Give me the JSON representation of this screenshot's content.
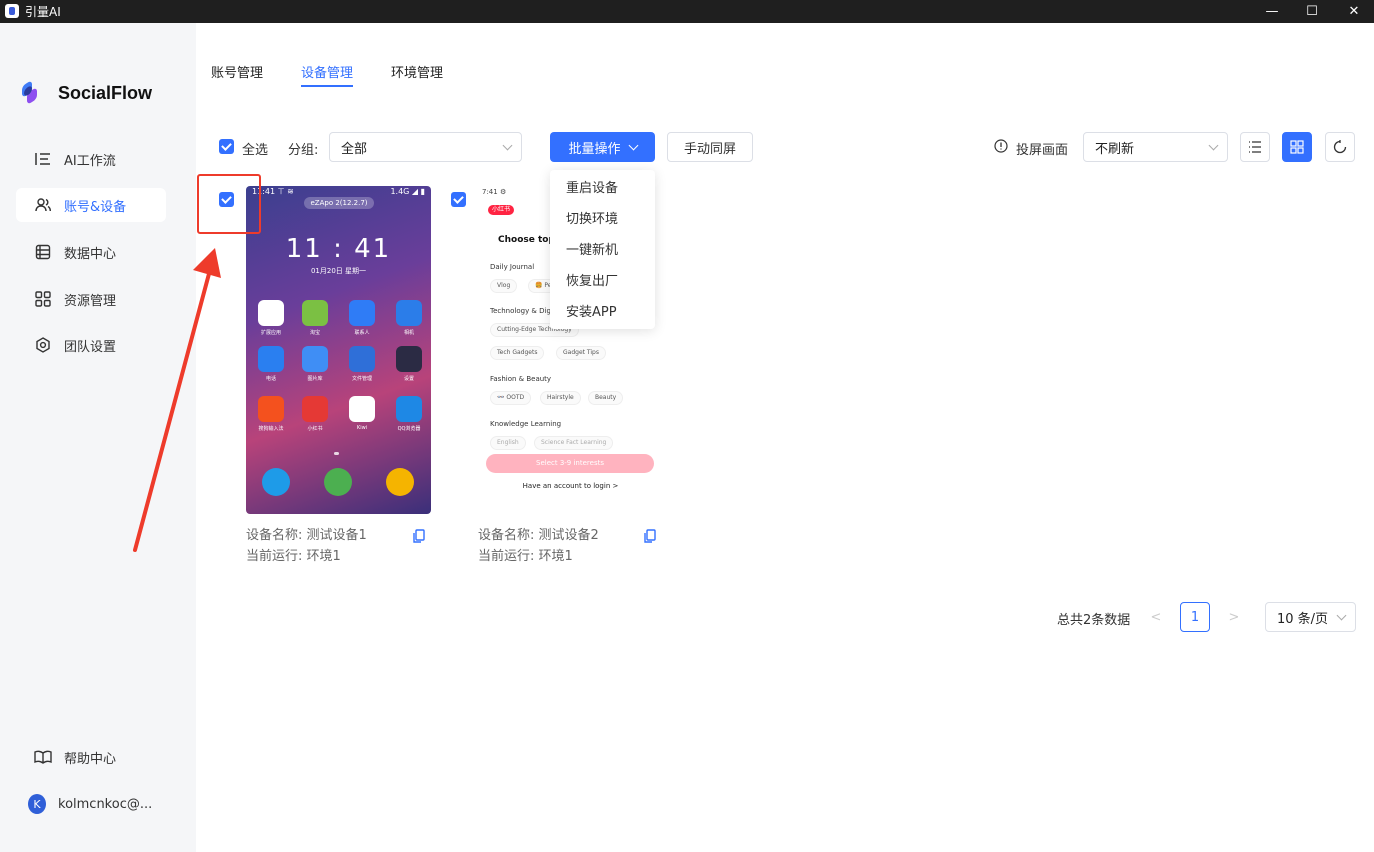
{
  "window": {
    "title": "引量AI",
    "minimize": "—",
    "maximize": "☐",
    "close": "✕"
  },
  "sidebar": {
    "brand": "SocialFlow",
    "items": [
      {
        "label": "AI工作流",
        "icon": "list-ordered-icon"
      },
      {
        "label": "账号&设备",
        "icon": "users-icon",
        "active": true
      },
      {
        "label": "数据中心",
        "icon": "database-icon"
      },
      {
        "label": "资源管理",
        "icon": "grid-icon"
      },
      {
        "label": "团队设置",
        "icon": "settings-icon"
      }
    ],
    "help": "帮助中心",
    "user": {
      "initial": "K",
      "name": "kolmcnkoc@..."
    }
  },
  "tabs": [
    {
      "label": "账号管理"
    },
    {
      "label": "设备管理",
      "active": true
    },
    {
      "label": "环境管理"
    }
  ],
  "toolbar": {
    "select_all": "全选",
    "group_label": "分组:",
    "group_value": "全部",
    "batch_label": "批量操作",
    "sync_label": "手动同屏",
    "cast_label": "投屏画面",
    "refresh_value": "不刷新"
  },
  "batch_menu": [
    "重启设备",
    "切换环境",
    "一键新机",
    "恢复出厂",
    "安装APP"
  ],
  "devices": [
    {
      "name_label": "设备名称:",
      "name": "测试设备1",
      "run_label": "当前运行:",
      "env": "环境1",
      "screen": {
        "status_left": "11:41 ⊤ ≋",
        "status_right": "1.4G ◢ ▮",
        "pill": "eZApo 2(12.2.7)",
        "clock": "11 : 41",
        "date": "01月20日 星期一",
        "apps": [
          "扩展应用",
          "淘宝",
          "联系人",
          "相机",
          "电话",
          "图片库",
          "文件管理",
          "设置",
          "搜狗输入法",
          "小红书",
          "Kiwi",
          "QQ浏览器"
        ],
        "app_colors": [
          "#ffffff",
          "#7bc043",
          "#2f7cf6",
          "#2b7de9",
          "#2a7ff0",
          "#3f8ef5",
          "#2f6fd8",
          "#2b2b44",
          "#f4511e",
          "#e53935",
          "#ffffff",
          "#1e88e5"
        ],
        "dock_colors": [
          "#1e9be8",
          "#4caf50",
          "#f5b400"
        ]
      }
    },
    {
      "name_label": "设备名称:",
      "name": "测试设备2",
      "run_label": "当前运行:",
      "env": "环境1",
      "screen": {
        "status": "7:41 ⚙",
        "badge": "小红书",
        "heading": "Choose top",
        "sections": [
          {
            "title": "Daily Journal",
            "chips": [
              "Vlog",
              "🍔 Pe"
            ]
          },
          {
            "title": "Technology & Dig",
            "chips": [
              "Cutting-Edge Technology",
              "Tech Gadgets",
              "Gadget Tips"
            ]
          },
          {
            "title": "Fashion & Beauty",
            "chips": [
              "👓 OOTD",
              "Hairstyle",
              "Beauty"
            ]
          },
          {
            "title": "Knowledge Learning",
            "chips": [
              "English",
              "Science Fact Learning"
            ]
          }
        ],
        "cta": "Select 3-9 interests",
        "login": "Have an account to login >"
      }
    }
  ],
  "pagination": {
    "total": "总共2条数据",
    "prev": "<",
    "current": "1",
    "next": ">",
    "page_size": "10 条/页"
  },
  "colors": {
    "accent": "#3370ff",
    "annotation": "#ee3b2b"
  }
}
